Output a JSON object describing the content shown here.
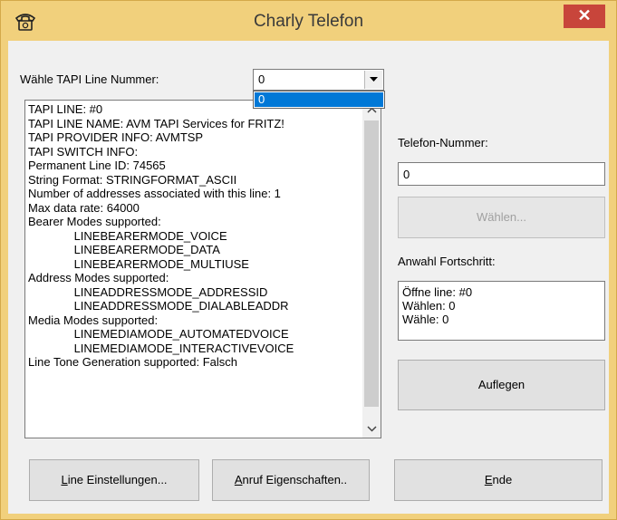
{
  "window": {
    "title": "Charly Telefon",
    "close_symbol": "✕",
    "app_icon": "telephone-icon",
    "colors": {
      "titlebar": "#f1d07c",
      "close": "#c8453b",
      "selection": "#0078d7"
    }
  },
  "line_select": {
    "label": "Wähle TAPI Line Nummer:",
    "value": "0",
    "options": [
      "0"
    ]
  },
  "info_lines": [
    "TAPI LINE: #0",
    "TAPI LINE NAME: AVM TAPI Services for FRITZ!",
    "TAPI PROVIDER INFO: AVMTSP",
    "TAPI SWITCH INFO:",
    "Permanent Line ID: 74565",
    "String Format: STRINGFORMAT_ASCII",
    "Number of addresses associated with this line: 1",
    "Max data rate: 64000",
    "Bearer Modes supported:",
    "              LINEBEARERMODE_VOICE",
    "              LINEBEARERMODE_DATA",
    "              LINEBEARERMODE_MULTIUSE",
    "Address Modes supported:",
    "              LINEADDRESSMODE_ADDRESSID",
    "              LINEADDRESSMODE_DIALABLEADDR",
    "Media Modes supported:",
    "              LINEMEDIAMODE_AUTOMATEDVOICE",
    "              LINEMEDIAMODE_INTERACTIVEVOICE",
    "Line Tone Generation supported: Falsch"
  ],
  "phone": {
    "label": "Telefon-Nummer:",
    "value": "0",
    "dial_button": "Wählen..."
  },
  "progress": {
    "label": "Anwahl Fortschritt:",
    "lines": [
      "Öffne line: #0",
      "Wählen: 0",
      "Wähle: 0"
    ]
  },
  "buttons": {
    "hangup": "Auflegen",
    "line_settings_accel": "L",
    "line_settings_rest": "ine Einstellungen...",
    "call_props_accel": "A",
    "call_props_rest": "nruf Eigenschaften..",
    "end_accel": "E",
    "end_rest": "nde"
  }
}
